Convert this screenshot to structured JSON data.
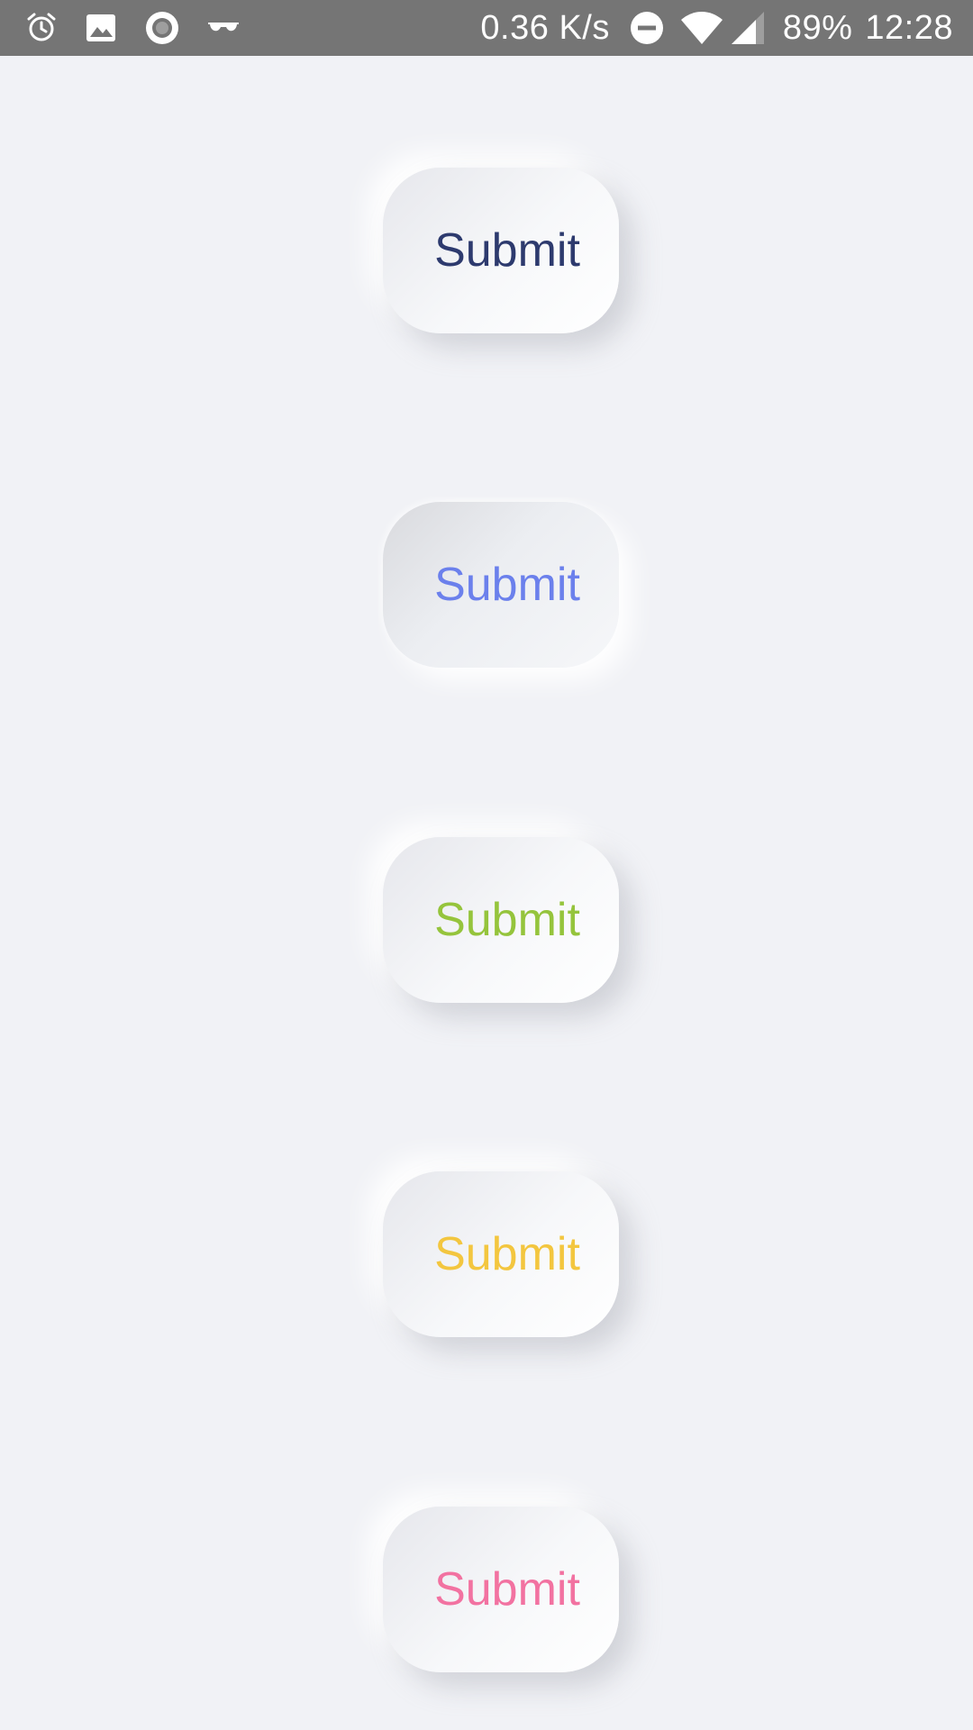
{
  "status_bar": {
    "left_icons": [
      "alarm-icon",
      "image-icon",
      "record-icon",
      "glasses-icon"
    ],
    "network_speed": "0.36 K/s",
    "right_icons": [
      "do-not-disturb-icon",
      "wifi-icon",
      "cell-signal-icon"
    ],
    "battery": "89%",
    "time": "12:28"
  },
  "buttons": [
    {
      "label": "Submit",
      "color": "#2d3a6e",
      "state": "raised"
    },
    {
      "label": "Submit",
      "color": "#6b80ec",
      "state": "pressed"
    },
    {
      "label": "Submit",
      "color": "#95c43c",
      "state": "raised"
    },
    {
      "label": "Submit",
      "color": "#f3c63f",
      "state": "raised"
    },
    {
      "label": "Submit",
      "color": "#f272a1",
      "state": "raised"
    }
  ],
  "colors": {
    "background": "#f1f2f6",
    "status_bar": "#757575"
  }
}
